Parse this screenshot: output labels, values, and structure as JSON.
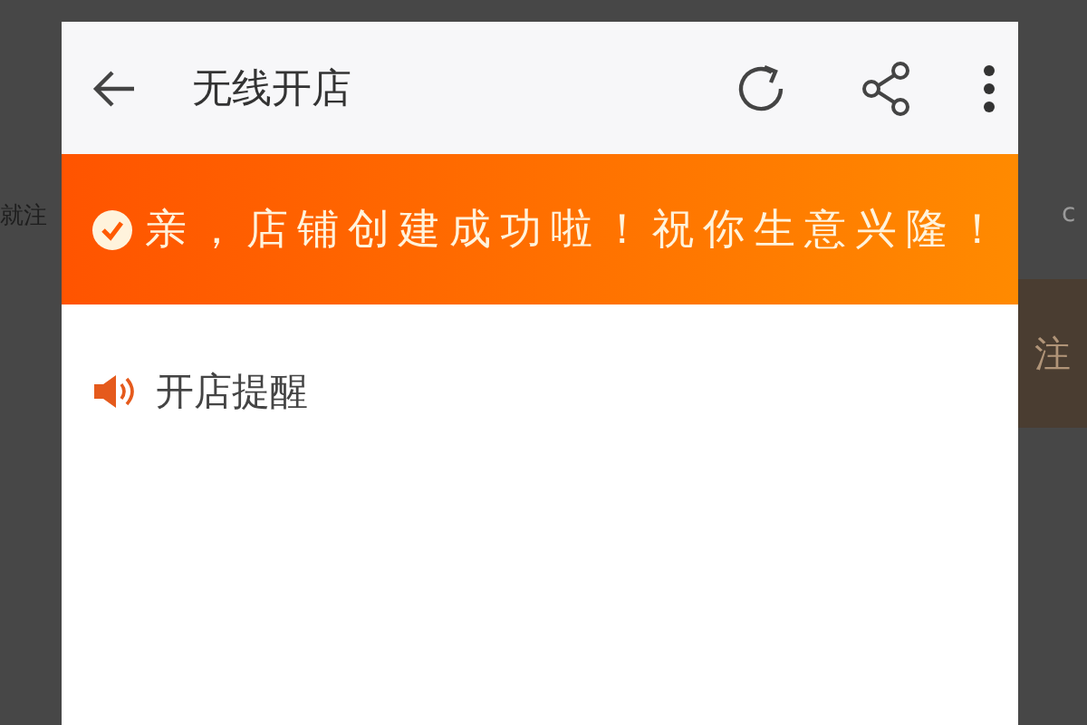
{
  "background": {
    "left_text": "就注",
    "right_text": "c",
    "right_button": "注"
  },
  "app_bar": {
    "title": "无线开店"
  },
  "banner": {
    "message": "亲，店铺创建成功啦！祝你生意兴隆！"
  },
  "notice": {
    "label": "开店提醒"
  }
}
